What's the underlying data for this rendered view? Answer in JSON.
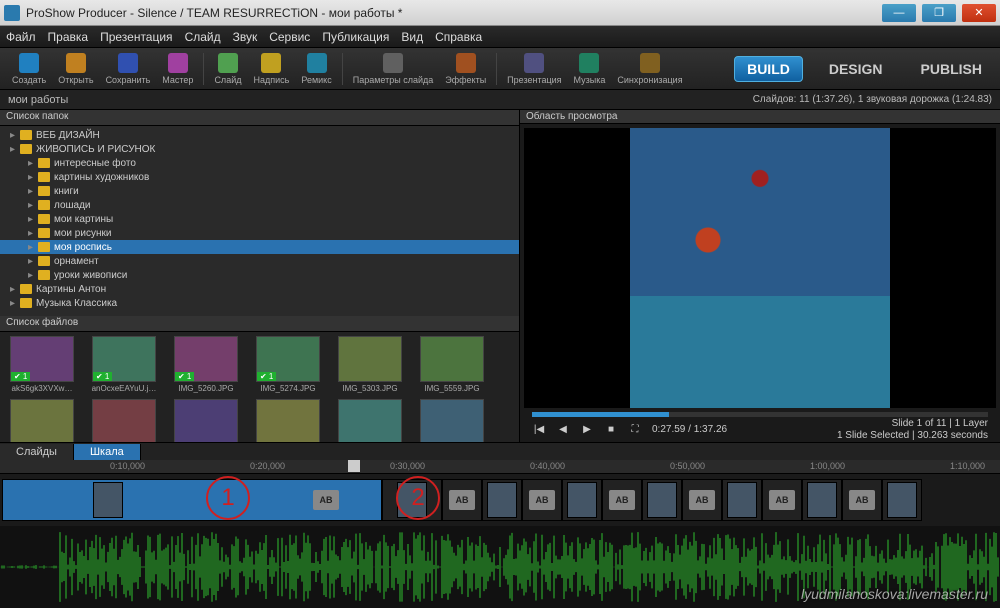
{
  "window": {
    "title": "ProShow Producer - Silence / TEAM RESURRECTiON - мои работы *"
  },
  "menu": [
    "Файл",
    "Правка",
    "Презентация",
    "Слайд",
    "Звук",
    "Сервис",
    "Публикация",
    "Вид",
    "Справка"
  ],
  "toolbar": [
    {
      "label": "Создать",
      "color": "#2080c0"
    },
    {
      "label": "Открыть",
      "color": "#c08020"
    },
    {
      "label": "Сохранить",
      "color": "#3050b0"
    },
    {
      "label": "Мастер",
      "color": "#a040a0"
    },
    {
      "label": "Слайд",
      "color": "#50a050"
    },
    {
      "label": "Надпись",
      "color": "#c0a020"
    },
    {
      "label": "Ремикс",
      "color": "#2080a0"
    },
    {
      "label": "Параметры слайда",
      "color": "#606060"
    },
    {
      "label": "Эффекты",
      "color": "#a05020"
    },
    {
      "label": "Презентация",
      "color": "#505080"
    },
    {
      "label": "Музыка",
      "color": "#208060"
    },
    {
      "label": "Синхронизация",
      "color": "#806020"
    }
  ],
  "modes": {
    "build": "BUILD",
    "design": "DESIGN",
    "publish": "PUBLISH"
  },
  "project": {
    "name": "мои работы",
    "status": "Слайдов: 11 (1:37.26), 1 звуковая дорожка (1:24.83)"
  },
  "panes": {
    "folders": "Список папок",
    "files": "Список файлов",
    "preview": "Область просмотра"
  },
  "tree": [
    {
      "d": 0,
      "l": "ВЕБ ДИЗАЙН"
    },
    {
      "d": 0,
      "l": "ЖИВОПИСЬ И РИСУНОК"
    },
    {
      "d": 1,
      "l": "интересные фото"
    },
    {
      "d": 1,
      "l": "картины художников"
    },
    {
      "d": 1,
      "l": "книги"
    },
    {
      "d": 1,
      "l": "лошади"
    },
    {
      "d": 1,
      "l": "мои картины"
    },
    {
      "d": 1,
      "l": "мои рисунки"
    },
    {
      "d": 1,
      "l": "моя роспись",
      "sel": true
    },
    {
      "d": 1,
      "l": "орнамент"
    },
    {
      "d": 1,
      "l": "уроки живописи"
    },
    {
      "d": 0,
      "l": "Картины Антон"
    },
    {
      "d": 0,
      "l": "Музыка Классика"
    }
  ],
  "files": [
    {
      "name": "akS6gk3XVXw…",
      "b": "1"
    },
    {
      "name": "anOcxeEAYuU.j…",
      "b": "1"
    },
    {
      "name": "IMG_5260.JPG",
      "b": "1"
    },
    {
      "name": "IMG_5274.JPG",
      "b": "1"
    },
    {
      "name": "IMG_5303.JPG"
    },
    {
      "name": "IMG_5559.JPG"
    },
    {
      "name": ""
    },
    {
      "name": ""
    },
    {
      "name": ""
    },
    {
      "name": ""
    },
    {
      "name": ""
    },
    {
      "name": ""
    }
  ],
  "player": {
    "time": "0:27.59 / 1:37.26",
    "info1": "Slide 1 of 11 | 1 Layer",
    "info2": "1 Slide Selected | 30.263 seconds"
  },
  "timeline": {
    "tabs": {
      "slides": "Слайды",
      "scale": "Шкала"
    },
    "ticks": [
      "0:10,000",
      "0:20,000",
      "0:30,000",
      "0:40,000",
      "0:50,000",
      "1:00,000",
      "1:10,000"
    ],
    "anno1": "1",
    "anno2": "2"
  },
  "watermark": "lyudmilanoskova:livemaster.ru"
}
